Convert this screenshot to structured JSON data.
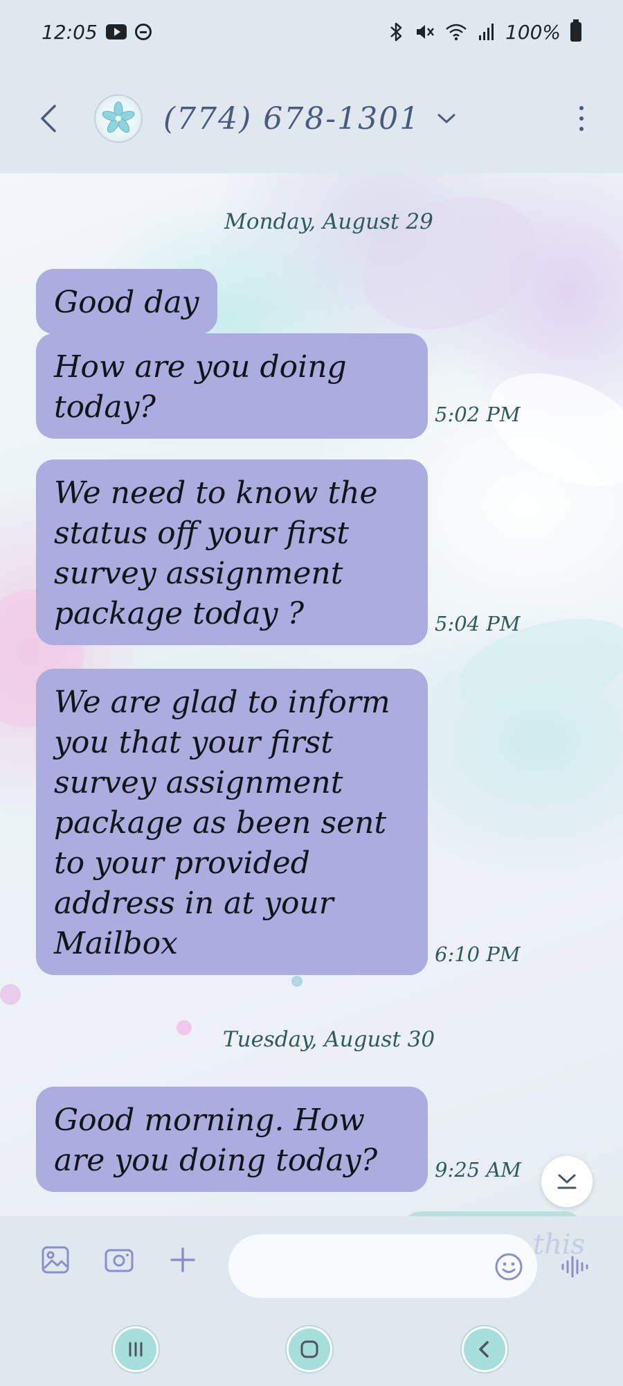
{
  "status_bar": {
    "time": "12:05",
    "battery": "100%",
    "icons": [
      "youtube-icon",
      "dnd-icon",
      "bluetooth-icon",
      "mute-icon",
      "wifi-icon",
      "signal-icon",
      "battery-icon"
    ]
  },
  "header": {
    "contact": "(774) 678-1301",
    "avatar_icon": "flower-icon"
  },
  "conversation": {
    "dates": [
      "Monday, August 29",
      "Tuesday, August 30"
    ],
    "messages": [
      {
        "text": "Good day",
        "time": ""
      },
      {
        "text": "How are you doing today?",
        "time": "5:02 PM"
      },
      {
        "text": "We need to know the status off your first survey assignment package today ?",
        "time": "5:04 PM"
      },
      {
        "text": "We are glad to inform you that your first survey assignment package as been sent to your provided address in at your Mailbox",
        "time": "6:10 PM"
      },
      {
        "text": "Good morning. How are you doing today?",
        "time": "9:25 AM"
      }
    ]
  },
  "composer": {
    "placeholder": "",
    "ghost_text": "this"
  },
  "colors": {
    "bubble": "#aaadde",
    "accent": "#4a5a7e",
    "timestamp": "#2f5a5e",
    "nav_button": "#a6dedb"
  }
}
